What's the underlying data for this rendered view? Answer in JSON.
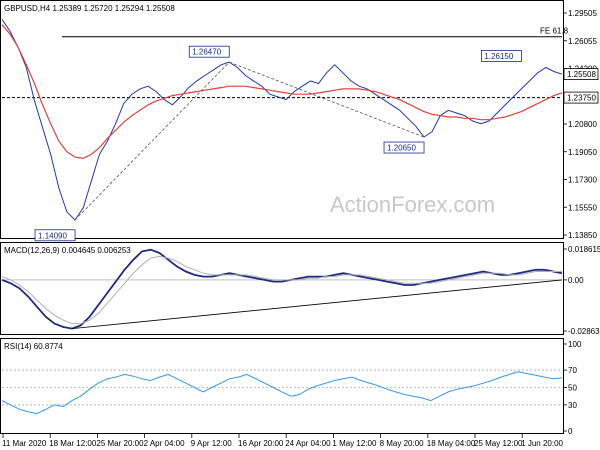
{
  "chart_data": [
    {
      "type": "line",
      "panel": "price",
      "header": "GBPUSD,H4 1.25389 1.25720 1.25294 1.25508",
      "ylim": [
        1.134,
        1.3
      ],
      "y_ticks": [
        "1.29505",
        "1.26055",
        "1.24300",
        "1.22550",
        "1.20800",
        "1.19050",
        "1.17300",
        "1.15550",
        "1.13850"
      ],
      "current_price": "1.25508",
      "horizontal_levels": [
        {
          "label": "FE 61.8",
          "value": 1.283
        },
        {
          "label": "1.23750",
          "value": 1.2375
        }
      ],
      "annotations": [
        "1.26470",
        "1.26150",
        "1.20650",
        "1.14090"
      ],
      "series": [
        {
          "name": "",
          "color": "#1f39b8",
          "values": [
            1.296,
            1.287,
            1.275,
            1.26,
            1.235,
            1.215,
            1.195,
            1.17,
            1.152,
            1.146,
            1.155,
            1.175,
            1.195,
            1.205,
            1.218,
            1.233,
            1.24,
            1.244,
            1.246,
            1.242,
            1.236,
            1.232,
            1.238,
            1.245,
            1.25,
            1.254,
            1.258,
            1.262,
            1.264,
            1.26,
            1.254,
            1.25,
            1.246,
            1.24,
            1.238,
            1.236,
            1.242,
            1.246,
            1.25,
            1.248,
            1.256,
            1.262,
            1.256,
            1.25,
            1.246,
            1.244,
            1.24,
            1.236,
            1.232,
            1.228,
            1.222,
            1.216,
            1.208,
            1.212,
            1.224,
            1.228,
            1.226,
            1.224,
            1.22,
            1.218,
            1.22,
            1.226,
            1.232,
            1.238,
            1.244,
            1.25,
            1.256,
            1.26,
            1.257,
            1.255
          ]
        },
        {
          "name": "",
          "color": "#e04040",
          "values": [
            1.292,
            1.285,
            1.275,
            1.262,
            1.248,
            1.232,
            1.218,
            1.205,
            1.197,
            1.193,
            1.192,
            1.195,
            1.2,
            1.207,
            1.213,
            1.219,
            1.224,
            1.228,
            1.232,
            1.235,
            1.237,
            1.239,
            1.24,
            1.241,
            1.242,
            1.243,
            1.244,
            1.245,
            1.246,
            1.246,
            1.246,
            1.245,
            1.244,
            1.243,
            1.242,
            1.241,
            1.24,
            1.24,
            1.24,
            1.241,
            1.242,
            1.243,
            1.244,
            1.244,
            1.244,
            1.243,
            1.242,
            1.24,
            1.238,
            1.236,
            1.233,
            1.23,
            1.227,
            1.225,
            1.224,
            1.223,
            1.223,
            1.222,
            1.222,
            1.221,
            1.221,
            1.222,
            1.223,
            1.225,
            1.227,
            1.23,
            1.233,
            1.236,
            1.239,
            1.241
          ]
        }
      ],
      "trendlines": [
        {
          "from": [
            9,
            1.146
          ],
          "to": [
            28,
            1.264
          ]
        },
        {
          "from": [
            28,
            1.264
          ],
          "to": [
            52,
            1.208
          ]
        }
      ],
      "watermark": "ActionForex.com"
    },
    {
      "type": "line",
      "panel": "macd",
      "header": "MACD(12,26,9) 0.004645 0.006253",
      "ylim": [
        -0.031,
        0.019
      ],
      "y_ticks": [
        "0.018615",
        "0.00",
        "-0.028631"
      ],
      "series": [
        {
          "name": "",
          "color": "#1f2a80",
          "values": [
            0.0,
            -0.002,
            -0.005,
            -0.01,
            -0.016,
            -0.022,
            -0.026,
            -0.028,
            -0.029,
            -0.027,
            -0.022,
            -0.015,
            -0.008,
            -0.001,
            0.006,
            0.012,
            0.017,
            0.018,
            0.016,
            0.012,
            0.008,
            0.005,
            0.003,
            0.002,
            0.002,
            0.003,
            0.004,
            0.003,
            0.002,
            0.001,
            0.0,
            -0.001,
            -0.001,
            0.0,
            0.001,
            0.002,
            0.002,
            0.002,
            0.003,
            0.004,
            0.003,
            0.002,
            0.001,
            0.0,
            -0.001,
            -0.002,
            -0.003,
            -0.003,
            -0.002,
            -0.001,
            0.0,
            0.001,
            0.002,
            0.003,
            0.004,
            0.005,
            0.004,
            0.003,
            0.003,
            0.004,
            0.005,
            0.006,
            0.006,
            0.005,
            0.004
          ]
        },
        {
          "name": "",
          "color": "#b0b0b0",
          "values": [
            0.002,
            0.0,
            -0.003,
            -0.007,
            -0.012,
            -0.017,
            -0.021,
            -0.024,
            -0.026,
            -0.026,
            -0.024,
            -0.02,
            -0.014,
            -0.008,
            -0.002,
            0.004,
            0.009,
            0.013,
            0.014,
            0.013,
            0.011,
            0.008,
            0.006,
            0.004,
            0.003,
            0.003,
            0.003,
            0.003,
            0.003,
            0.002,
            0.001,
            0.0,
            0.0,
            0.0,
            0.0,
            0.001,
            0.001,
            0.002,
            0.002,
            0.003,
            0.003,
            0.003,
            0.002,
            0.001,
            0.0,
            -0.001,
            -0.002,
            -0.002,
            -0.002,
            -0.002,
            -0.001,
            0.0,
            0.001,
            0.002,
            0.003,
            0.004,
            0.004,
            0.004,
            0.003,
            0.003,
            0.004,
            0.005,
            0.005,
            0.005,
            0.005
          ]
        }
      ],
      "trendlines": [
        {
          "from": [
            8,
            -0.029
          ],
          "to": [
            64,
            0.0
          ]
        }
      ]
    },
    {
      "type": "line",
      "panel": "rsi",
      "header": "RSI(14) 60.8774",
      "ylim": [
        0,
        100
      ],
      "y_ticks": [
        "100",
        "70",
        "50",
        "30",
        "0"
      ],
      "levels": [
        70,
        50,
        30
      ],
      "series": [
        {
          "name": "",
          "color": "#3399ee",
          "values": [
            35,
            30,
            25,
            22,
            20,
            25,
            30,
            28,
            35,
            40,
            48,
            55,
            60,
            62,
            65,
            63,
            60,
            58,
            62,
            65,
            60,
            55,
            50,
            45,
            50,
            55,
            60,
            62,
            65,
            60,
            55,
            50,
            45,
            40,
            42,
            48,
            52,
            55,
            58,
            60,
            62,
            58,
            55,
            52,
            48,
            45,
            42,
            40,
            38,
            35,
            40,
            45,
            48,
            50,
            52,
            55,
            58,
            62,
            65,
            68,
            66,
            64,
            62,
            60,
            61
          ]
        }
      ]
    }
  ],
  "x_labels": [
    "11 Mar 2020",
    "18 Mar 12:00",
    "25 Mar 20:00",
    "2 Apr 04:00",
    "9 Apr 12:00",
    "16 Apr 20:00",
    "24 Apr 04:00",
    "1 May 12:00",
    "8 May 20:00",
    "18 May 04:00",
    "25 May 12:00",
    "1 Jun 20:00"
  ]
}
